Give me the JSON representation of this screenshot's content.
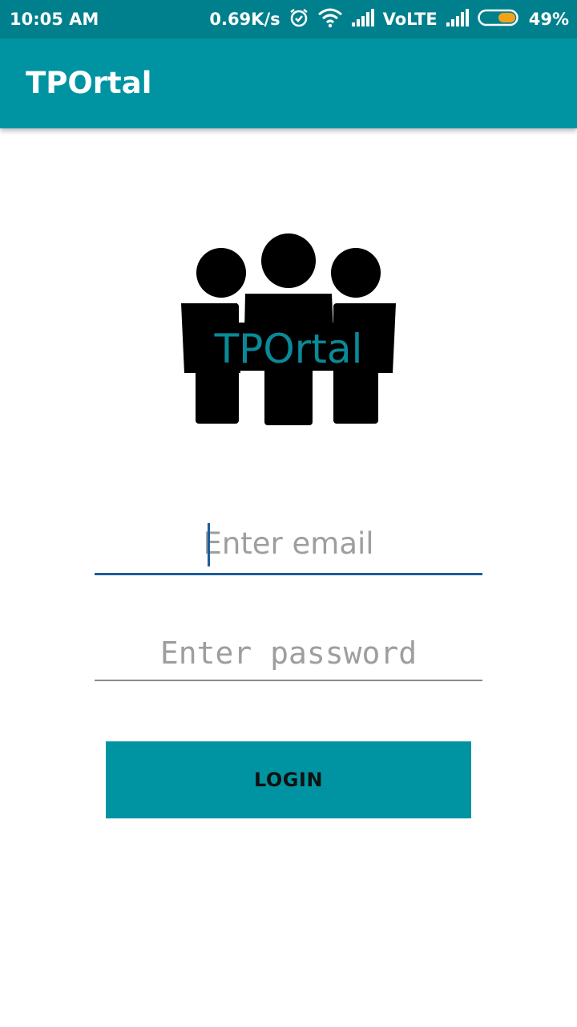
{
  "status_bar": {
    "time": "10:05 AM",
    "network_speed": "0.69K/s",
    "network_type": "VoLTE",
    "battery": "49%",
    "battery_level": 0.49,
    "icons": [
      "alarm-icon",
      "wifi-icon",
      "signal-icon",
      "signal-icon",
      "battery-icon"
    ]
  },
  "app_bar": {
    "title": "TPOrtal"
  },
  "logo": {
    "text": "TPOrtal",
    "text_color": "#0a8a98"
  },
  "form": {
    "email_placeholder": "Enter email",
    "email_value": "",
    "password_placeholder": "Enter password",
    "password_value": "",
    "login_label": "LOGIN"
  },
  "colors": {
    "status_bar": "#00808c",
    "primary": "#0094a2",
    "focus_underline": "#1f5c9c",
    "battery_fill": "#f4a11c"
  }
}
